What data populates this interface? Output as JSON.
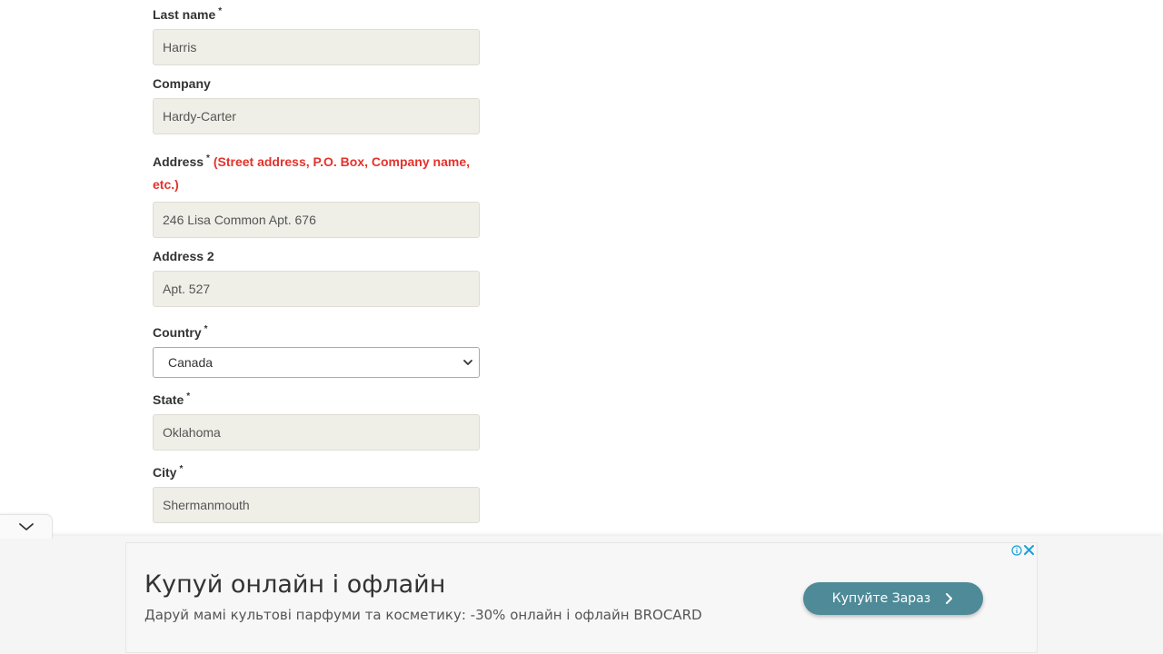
{
  "form": {
    "last_name": {
      "label": "Last name",
      "required_mark": "*",
      "value": "Harris"
    },
    "company": {
      "label": "Company",
      "value": "Hardy-Carter"
    },
    "address": {
      "label": "Address",
      "required_mark": "*",
      "hint": "(Street address, P.O. Box, Company name, etc.)",
      "value": "246 Lisa Common Apt. 676"
    },
    "address2": {
      "label": "Address 2",
      "value": "Apt. 527"
    },
    "country": {
      "label": "Country",
      "required_mark": "*",
      "selected": "Canada"
    },
    "state": {
      "label": "State",
      "required_mark": "*",
      "value": "Oklahoma"
    },
    "city": {
      "label": "City",
      "required_mark": "*",
      "value": "Shermanmouth"
    },
    "next_field": {
      "required_mark": "*"
    }
  },
  "ad": {
    "headline": "Купуй онлайн і офлайн",
    "body": "Даруй мамі культові парфуми та косметику: -30% онлайн і офлайн BROCARD",
    "cta_label": "Купуйте Зараз",
    "accent_color": "#4e8a98",
    "icons": [
      "chevron-down-icon",
      "info-icon",
      "close-icon",
      "chevron-right-icon"
    ]
  }
}
